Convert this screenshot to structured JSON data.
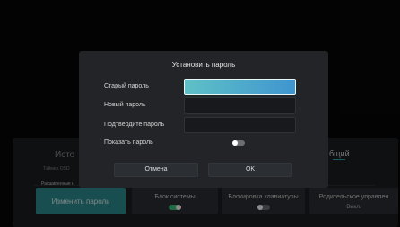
{
  "background": {
    "tab_left": "Исто",
    "tab_right": "бщий",
    "timer_label": "Таймер OSD",
    "advanced_label": "Расширенные н",
    "tiles": {
      "change_password": {
        "label": "Изменить пароль"
      },
      "system_lock": {
        "label": "Блок системы",
        "toggle_on": true
      },
      "keyboard_lock": {
        "label": "Блокировка клавиатуры",
        "toggle_on": false
      },
      "parental": {
        "label": "Родительское управлен",
        "value": "Выкл."
      }
    }
  },
  "dialog": {
    "title": "Установить пароль",
    "fields": {
      "old_password": {
        "label": "Старый пароль",
        "value": ""
      },
      "new_password": {
        "label": "Новый пароль",
        "value": ""
      },
      "confirm_password": {
        "label": "Подтвердите пароль",
        "value": ""
      }
    },
    "show_password": {
      "label": "Показать пароль",
      "toggle_on": false
    },
    "cancel_label": "Отмена",
    "ok_label": "OK"
  },
  "colors": {
    "accent": "#2f8f92",
    "toggle_on": "#3fbf7f",
    "toggle_off": "#6b6e73"
  }
}
